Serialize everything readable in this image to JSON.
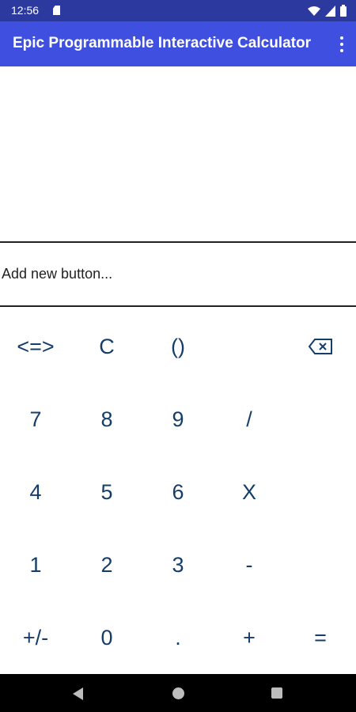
{
  "status_bar": {
    "time": "12:56",
    "icons": [
      "sd-card-icon",
      "wifi-icon",
      "signal-icon",
      "battery-icon"
    ]
  },
  "app_bar": {
    "title": "Epic Programmable Interactive Calculator",
    "menu_icon": "more-vert-icon"
  },
  "add_button_field": {
    "placeholder": "Add new button...",
    "value": ""
  },
  "keypad": {
    "rows": [
      [
        "<=>",
        "C",
        "()",
        "",
        "⌫"
      ],
      [
        "7",
        "8",
        "9",
        "/",
        ""
      ],
      [
        "4",
        "5",
        "6",
        "X",
        ""
      ],
      [
        "1",
        "2",
        "3",
        "-",
        ""
      ],
      [
        "+/-",
        "0",
        ".",
        "+",
        "="
      ]
    ],
    "backspace_icon": "backspace-icon"
  },
  "nav_bar": {
    "icons": [
      "back-icon",
      "home-icon",
      "recents-icon"
    ]
  },
  "colors": {
    "status_bar": "#2c3aa0",
    "app_bar": "#3f50e0",
    "key_text": "#143d6b"
  }
}
